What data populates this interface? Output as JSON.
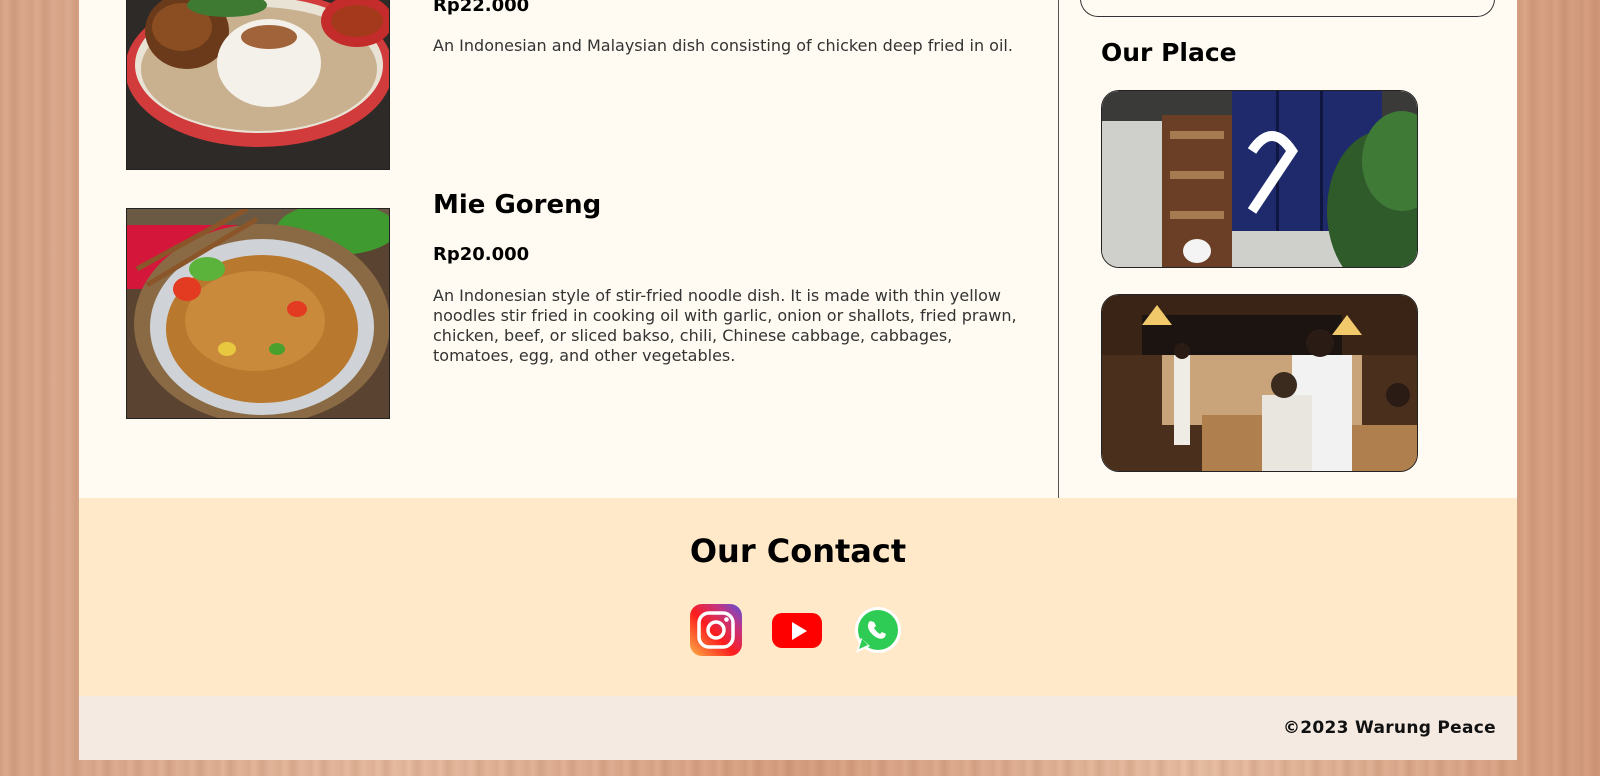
{
  "menu": {
    "items": [
      {
        "name": "",
        "price": "Rp22.000",
        "description": "An Indonesian and Malaysian dish consisting of chicken deep fried in oil."
      },
      {
        "name": "Mie Goreng",
        "price": "Rp20.000",
        "description": "An Indonesian style of stir-fried noodle dish. It is made with thin yellow noodles stir fried in cooking oil with garlic, onion or shallots, fried prawn, chicken, beef, or sliced bakso, chili, Chinese cabbage, cabbages, tomatoes, egg, and other vegetables."
      }
    ]
  },
  "sidebar": {
    "place_title": "Our Place"
  },
  "contact": {
    "title": "Our Contact",
    "icons": [
      "instagram-icon",
      "youtube-icon",
      "whatsapp-icon"
    ]
  },
  "footer": {
    "copyright": "©2023 Warung Peace"
  },
  "colors": {
    "content_bg": "#fffbf2",
    "contact_bg": "#ffe9c8",
    "footer_bg": "#f4eae2"
  }
}
